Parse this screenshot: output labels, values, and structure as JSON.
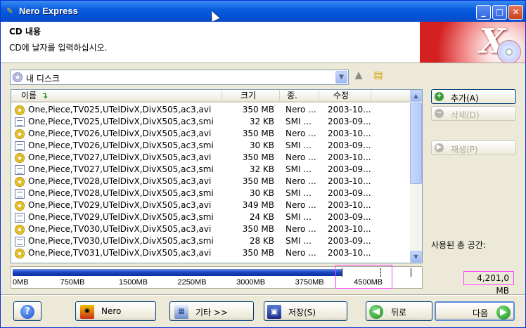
{
  "window": {
    "title": "Nero Express",
    "minimize": "_",
    "maximize": "□",
    "close": "✕"
  },
  "header": {
    "title": "CD 내용",
    "subtitle": "CD에 날자를 입력하십시오."
  },
  "location": {
    "selected": "내 디스크"
  },
  "columns": {
    "name": "이름",
    "size": "크기",
    "type": "종.",
    "modified": "수정"
  },
  "files": [
    {
      "name": "One,Piece,TV025,UTelDivX,DivX505,ac3,avi",
      "size": "350 MB",
      "type": "Nero ...",
      "date": "2003-10...",
      "icon": "avi"
    },
    {
      "name": "One,Piece,TV025,UTelDivX,DivX505,ac3,smi",
      "size": "32 KB",
      "type": "SMI ...",
      "date": "2003-09...",
      "icon": "smi"
    },
    {
      "name": "One,Piece,TV026,UTelDivX,DivX505,ac3,avi",
      "size": "350 MB",
      "type": "Nero ...",
      "date": "2003-10...",
      "icon": "avi"
    },
    {
      "name": "One,Piece,TV026,UTelDivX,DivX505,ac3,smi",
      "size": "30 KB",
      "type": "SMI ...",
      "date": "2003-09...",
      "icon": "smi"
    },
    {
      "name": "One,Piece,TV027,UTelDivX,DivX505,ac3,avi",
      "size": "350 MB",
      "type": "Nero ...",
      "date": "2003-10...",
      "icon": "avi"
    },
    {
      "name": "One,Piece,TV027,UTelDivX,DivX505,ac3,smi",
      "size": "32 KB",
      "type": "SMI ...",
      "date": "2003-09...",
      "icon": "smi"
    },
    {
      "name": "One,Piece,TV028,UTelDivX,DivX505,ac3,avi",
      "size": "350 MB",
      "type": "Nero ...",
      "date": "2003-10...",
      "icon": "avi"
    },
    {
      "name": "One,Piece,TV028,UTelDivX,DivX505,ac3,smi",
      "size": "30 KB",
      "type": "SMI ...",
      "date": "2003-09...",
      "icon": "smi"
    },
    {
      "name": "One,Piece,TV029,UTelDivX,DivX505,ac3,avi",
      "size": "349 MB",
      "type": "Nero ...",
      "date": "2003-10...",
      "icon": "avi"
    },
    {
      "name": "One,Piece,TV029,UTelDivX,DivX505,ac3,smi",
      "size": "24 KB",
      "type": "SMI ...",
      "date": "2003-09...",
      "icon": "smi"
    },
    {
      "name": "One,Piece,TV030,UTelDivX,DivX505,ac3,avi",
      "size": "350 MB",
      "type": "Nero ...",
      "date": "2003-10...",
      "icon": "avi"
    },
    {
      "name": "One,Piece,TV030,UTelDivX,DivX505,ac3,smi",
      "size": "28 KB",
      "type": "SMI ...",
      "date": "2003-09...",
      "icon": "smi"
    },
    {
      "name": "One,Piece,TV031,UTelDivX,DivX505,ac3,avi",
      "size": "350 MB",
      "type": "Nero ...",
      "date": "2003-10...",
      "icon": "avi"
    }
  ],
  "capacity": {
    "ticks": [
      "0MB",
      "750MB",
      "1500MB",
      "2250MB",
      "3000MB",
      "3750MB",
      "4500MB"
    ],
    "tick_values_mb": [
      0,
      750,
      1500,
      2250,
      3000,
      3750,
      4500
    ],
    "scale_max_mb": 5000,
    "used_mb": 4201.0,
    "marker_mb": 4700,
    "used_label": "사용된 총 공간:",
    "used_value": "4,201,0 MB"
  },
  "side_buttons": {
    "add": "추가(A)",
    "delete": "삭제(D)",
    "play": "재생(P)"
  },
  "buttons": {
    "help": "?",
    "nero": "Nero",
    "more": "기타 >>",
    "save": "저장(S)",
    "back": "뒤로",
    "next": "다음"
  },
  "colors": {
    "title_bar": "#0a5ee0",
    "highlight_box": "#ff44ff",
    "bar_fill": "#1c45c2"
  }
}
